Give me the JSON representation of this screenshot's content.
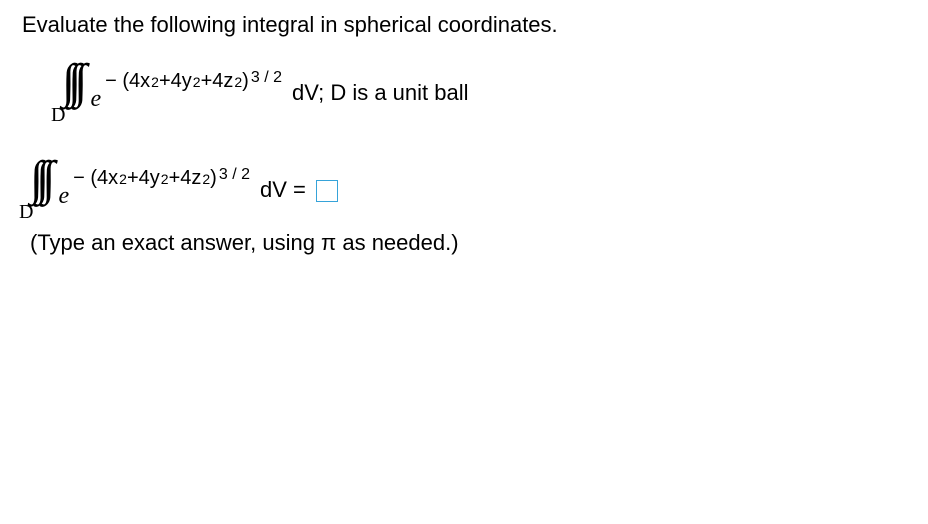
{
  "prompt": "Evaluate the following integral in spherical coordinates.",
  "integral": {
    "symbol": "∫∫∫",
    "domain": "D",
    "base": "e",
    "minus": "−",
    "lparen": "(",
    "t1a": "4x",
    "t1b": "2",
    "plus1": " + ",
    "t2a": "4y",
    "t2b": "2",
    "plus2": " + ",
    "t3a": "4z",
    "t3b": "2",
    "rparen": ")",
    "outer_exp": " 3 / 2",
    "dV": "dV;",
    "desc": " D is a unit ball"
  },
  "answer_line": {
    "dV": "dV",
    "equals": " = "
  },
  "hint": "(Type an exact answer, using π as needed.)"
}
